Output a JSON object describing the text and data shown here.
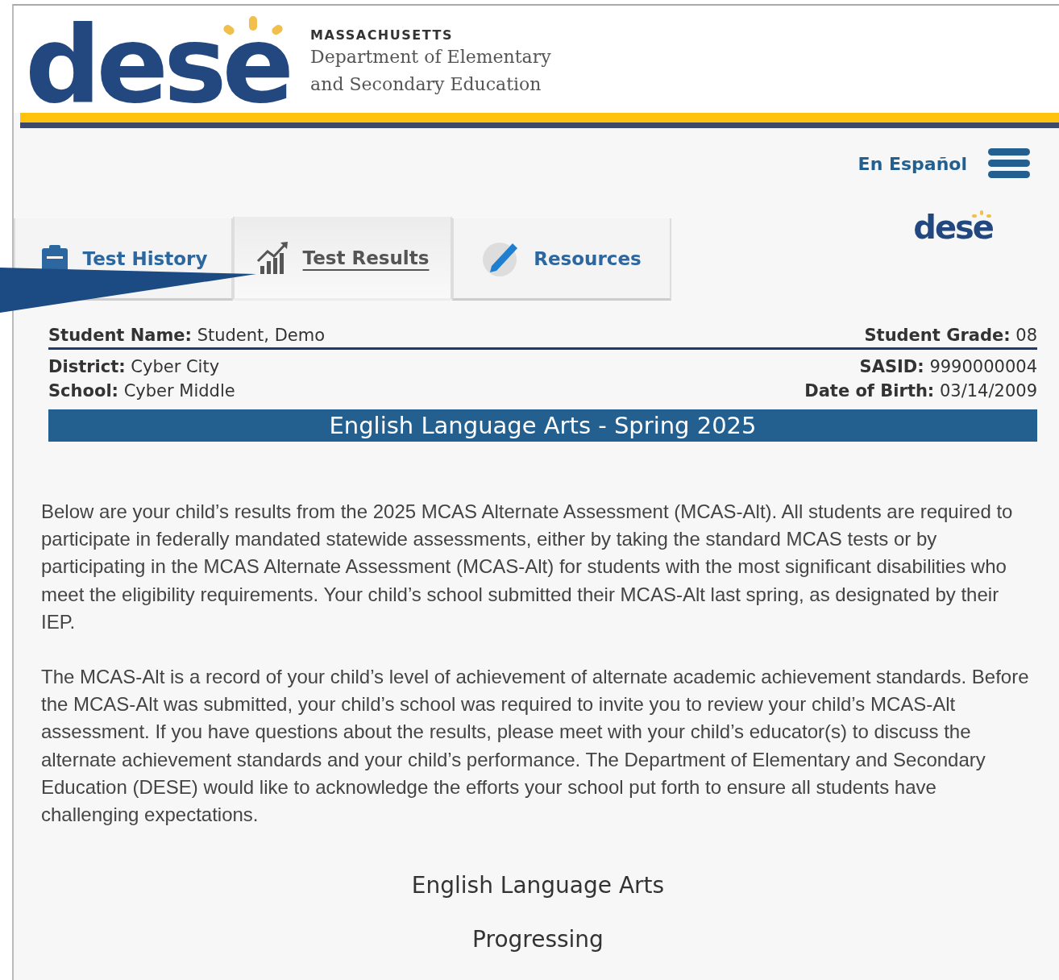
{
  "header": {
    "logo_text": "dese",
    "state": "MASSACHUSETTS",
    "department_lines": [
      "Department of Elementary",
      "and Secondary Education"
    ]
  },
  "top_nav": {
    "language_link": "En Español"
  },
  "small_logo_text": "dese",
  "tabs": [
    {
      "label": "Test History",
      "selected": false
    },
    {
      "label": "Test Results",
      "selected": true
    },
    {
      "label": "Resources",
      "selected": false
    }
  ],
  "student_info": {
    "left": [
      "**Student Name:** Student, Demo",
      "**District:** Cyber City",
      "**School:** Cyber Middle"
    ],
    "right": [
      "**Student Grade:** 08",
      "**SASID:** 9990000004",
      "**Date of Birth:** 03/14/2009"
    ]
  },
  "subject_banner": "English Language Arts - Spring 2025",
  "paragraphs": [
    "Below are your child’s results from the 2025 MCAS Alternate Assessment (MCAS-Alt). All students are required to participate in federally mandated statewide assessments, either by taking the standard MCAS tests or by participating in the MCAS Alternate Assessment (MCAS-Alt) for students with the most significant disabilities who meet the eligibility requirements. Your child’s school submitted their MCAS-Alt last spring, as designated by their IEP.",
    "The MCAS-Alt is a record of your child’s level of achievement of alternate academic achievement standards. Before the MCAS-Alt was submitted, your child’s school was required to invite you to review your child’s MCAS-Alt assessment. If you have questions about the results, please meet with your child’s educator(s) to discuss the alternate achievement standards and your child’s performance. The Department of Elementary and Secondary Education (DESE) would like to acknowledge the efforts your school put forth to ensure all students have challenging expectations."
  ],
  "result": {
    "subject": "English Language Arts",
    "level": "Progressing"
  }
}
